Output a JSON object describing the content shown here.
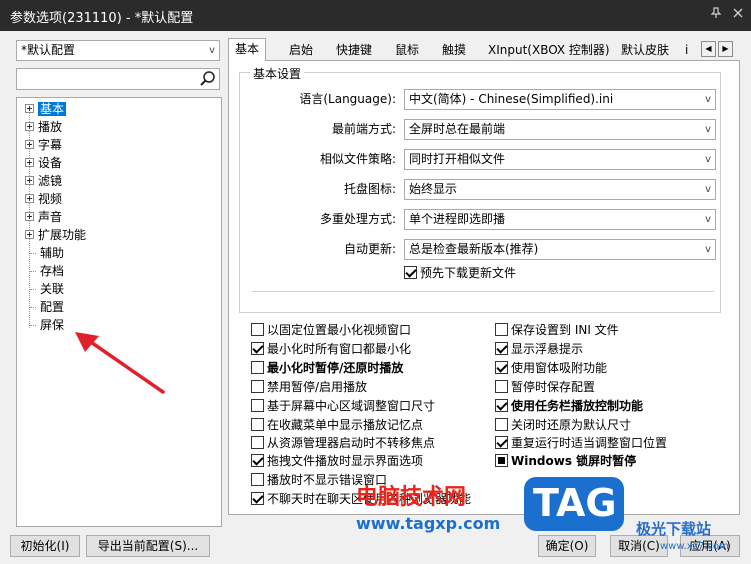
{
  "window": {
    "title": "参数选项(231110) - *默认配置"
  },
  "profile_select": {
    "value": "*默认配置"
  },
  "search": {
    "placeholder": ""
  },
  "tree": {
    "items": [
      {
        "label": "基本",
        "expandable": true,
        "selected": true
      },
      {
        "label": "播放",
        "expandable": true
      },
      {
        "label": "字幕",
        "expandable": true
      },
      {
        "label": "设备",
        "expandable": true
      },
      {
        "label": "滤镜",
        "expandable": true
      },
      {
        "label": "视频",
        "expandable": true
      },
      {
        "label": "声音",
        "expandable": true
      },
      {
        "label": "扩展功能",
        "expandable": true
      },
      {
        "label": "辅助",
        "expandable": false
      },
      {
        "label": "存档",
        "expandable": false
      },
      {
        "label": "关联",
        "expandable": false
      },
      {
        "label": "配置",
        "expandable": false
      },
      {
        "label": "屏保",
        "expandable": false
      }
    ]
  },
  "tabs": [
    "基本",
    "启始",
    "快捷键",
    "鼠标",
    "触摸",
    "XInput(XBOX 控制器)",
    "默认皮肤",
    "i"
  ],
  "basic": {
    "group_title": "基本设置",
    "rows": [
      {
        "label": "语言(Language):",
        "value": "中文(简体) - Chinese(Simplified).ini"
      },
      {
        "label": "最前端方式:",
        "value": "全屏时总在最前端"
      },
      {
        "label": "相似文件策略:",
        "value": "同时打开相似文件"
      },
      {
        "label": "托盘图标:",
        "value": "始终显示"
      },
      {
        "label": "多重处理方式:",
        "value": "单个进程即选即播"
      },
      {
        "label": "自动更新:",
        "value": "总是检查最新版本(推荐)"
      }
    ],
    "predownload": {
      "label": "预先下载更新文件",
      "checked": true
    }
  },
  "options_left": [
    {
      "label": "以固定位置最小化视频窗口",
      "checked": false,
      "bold": false
    },
    {
      "label": "最小化时所有窗口都最小化",
      "checked": true,
      "bold": false
    },
    {
      "label": "最小化时暂停/还原时播放",
      "checked": false,
      "bold": true
    },
    {
      "label": "禁用暂停/启用播放",
      "checked": false,
      "bold": false
    },
    {
      "label": "基于屏幕中心区域调整窗口尺寸",
      "checked": false,
      "bold": false
    },
    {
      "label": "在收藏菜单中显示播放记忆点",
      "checked": false,
      "bold": false
    },
    {
      "label": "从资源管理器启动时不转移焦点",
      "checked": false,
      "bold": false
    },
    {
      "label": "拖拽文件播放时显示界面选项",
      "checked": true,
      "bold": false
    },
    {
      "label": "播放时不显示错误窗口",
      "checked": false,
      "bold": false
    },
    {
      "label": "不聊天时在聊天区使用各种浏览器功能",
      "checked": true,
      "bold": false
    }
  ],
  "options_right": [
    {
      "label": "保存设置到 INI 文件",
      "checked": false,
      "bold": false
    },
    {
      "label": "显示浮悬提示",
      "checked": true,
      "bold": false
    },
    {
      "label": "使用窗体吸附功能",
      "checked": true,
      "bold": false
    },
    {
      "label": "暂停时保存配置",
      "checked": false,
      "bold": false
    },
    {
      "label": "使用任务栏播放控制功能",
      "checked": true,
      "bold": true
    },
    {
      "label": "关闭时还原为默认尺寸",
      "checked": false,
      "bold": false
    },
    {
      "label": "重复运行时适当调整窗口位置",
      "checked": true,
      "bold": false
    },
    {
      "label": "Windows 锁屏时暂停",
      "checked": "mixed",
      "bold": true
    }
  ],
  "buttons": {
    "init": "初始化(I)",
    "export": "导出当前配置(S)...",
    "ok": "确定(O)",
    "cancel": "取消(C)",
    "apply": "应用(A)"
  },
  "watermark": {
    "site_name": "电脑技术网",
    "site_url": "www.tagxp.com",
    "badge": "TAG",
    "corner": "极光下载站",
    "corner_url": "www.xz7.com"
  },
  "colors": {
    "accent": "#0078d7",
    "titlebar": "#2b2b2b",
    "watermark_red": "#e8251b",
    "watermark_blue": "#1a6fcf",
    "arrow": "#e0202a"
  }
}
